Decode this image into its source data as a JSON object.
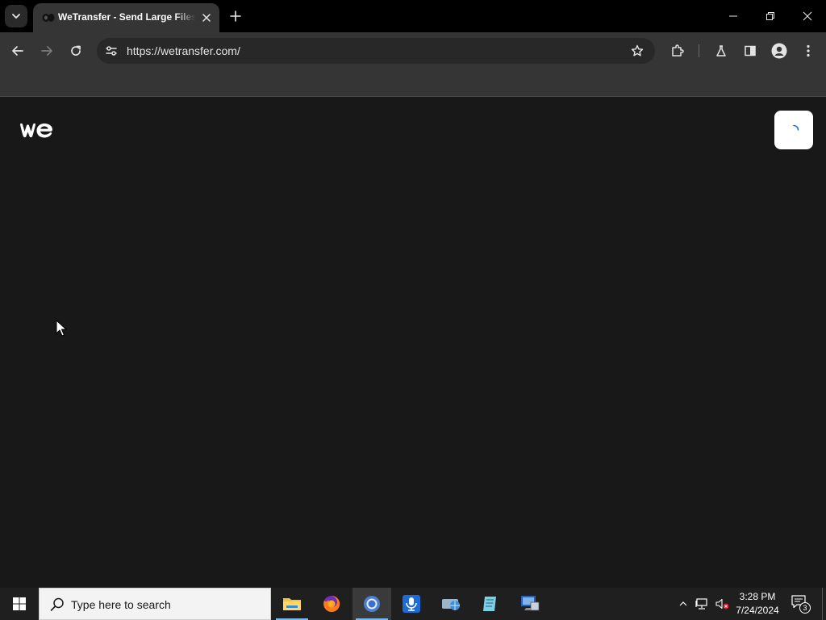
{
  "browser": {
    "tab": {
      "title": "WeTransfer - Send Large Files & Share Photos Online",
      "favicon": "wetransfer-favicon"
    },
    "address_bar": {
      "url": "https://wetransfer.com/"
    },
    "icons": {
      "back": "arrow-left-icon",
      "forward": "arrow-right-icon",
      "reload": "reload-icon",
      "site_info": "tune-icon",
      "bookmark": "star-icon",
      "extensions": "puzzle-icon",
      "labs": "flask-icon",
      "side_panel": "side-panel-icon",
      "profile": "profile-icon",
      "menu": "kebab-menu-icon"
    }
  },
  "page": {
    "logo": "we",
    "status": "loading",
    "colors": {
      "background": "#181818",
      "logo": "#ffffff",
      "spinner": "#1a73e8"
    }
  },
  "taskbar": {
    "search_placeholder": "Type here to search",
    "apps": [
      "file-explorer",
      "firefox",
      "chrome",
      "voice-recorder",
      "network-tool",
      "notepad-app",
      "remote-desktop"
    ],
    "active_app": "chrome",
    "tray": {
      "time": "3:28 PM",
      "date": "7/24/2024",
      "notification_count": "3"
    }
  }
}
